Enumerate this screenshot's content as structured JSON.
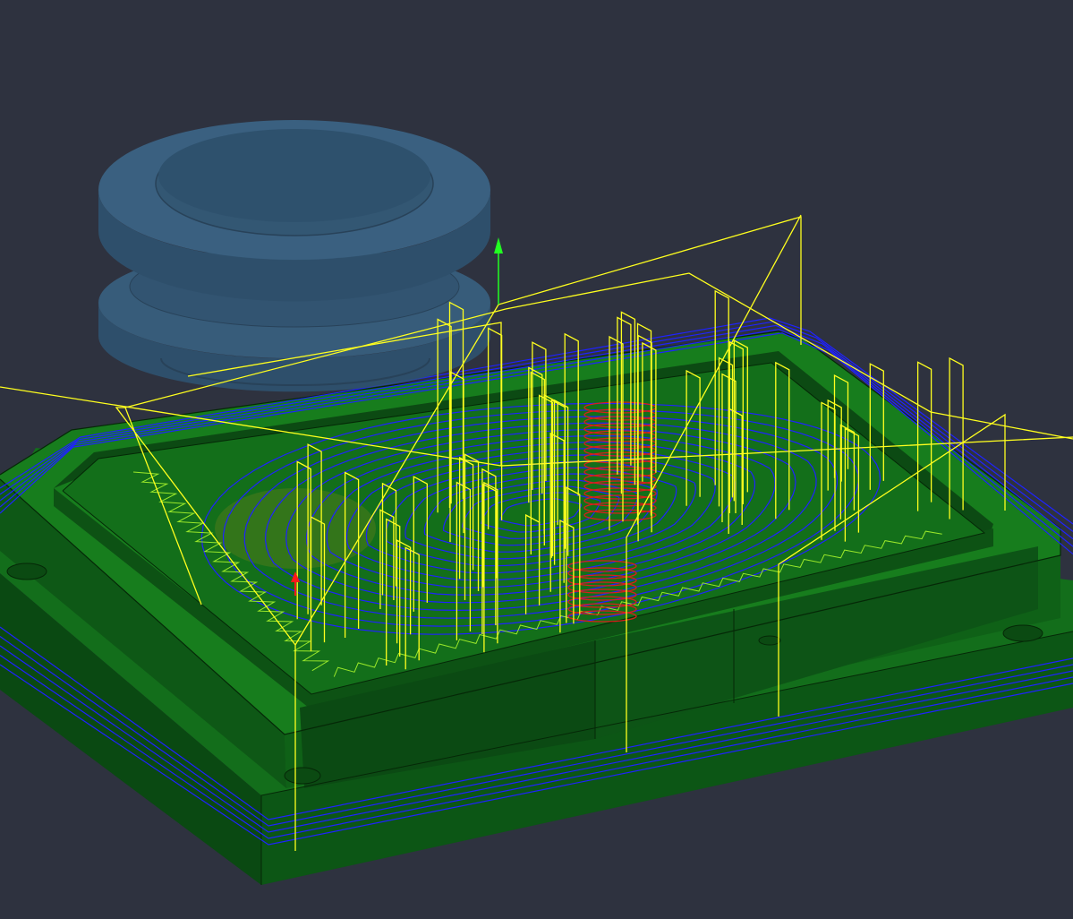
{
  "viewport": {
    "background_color": "#2e323f"
  },
  "colors": {
    "part_top": "#167a1c",
    "part_side": "#0c4e14",
    "part_mid": "#105f17",
    "part_edge": "#052807",
    "pocket_floor": "#3a6b1e",
    "rapid_moves": "#ffff1e",
    "cutting_moves": "#1f22ff",
    "finish_pass": "#9ae82a",
    "drill_cycles": "#d8201a",
    "tool_body": "#3a6688",
    "tool_holder_dark": "#2c4a63",
    "z_axis": "#22ff22",
    "start_point": "#ff1818"
  },
  "icons": {
    "tool": "cutting-tool-icon",
    "z_axis": "z-axis-arrow-icon",
    "start": "toolpath-start-marker-icon"
  }
}
